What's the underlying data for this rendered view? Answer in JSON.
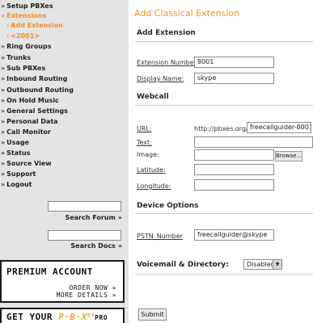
{
  "sidebar": {
    "items": [
      {
        "label": "Setup PBXes",
        "arrow": "»"
      },
      {
        "label": "Extensions",
        "arrow": "»"
      },
      {
        "label": "Add Extension",
        "arrow": "›"
      },
      {
        "label": "<2001>",
        "arrow": "›"
      },
      {
        "label": "Ring Groups",
        "arrow": "»"
      },
      {
        "label": "Trunks",
        "arrow": "»"
      },
      {
        "label": "Sub PBXes",
        "arrow": "»"
      },
      {
        "label": "Inbound Routing",
        "arrow": "»"
      },
      {
        "label": "Outbound Routing",
        "arrow": "»"
      },
      {
        "label": "On Hold Music",
        "arrow": "»"
      },
      {
        "label": "General Settings",
        "arrow": "»"
      },
      {
        "label": "Personal Data",
        "arrow": "»"
      },
      {
        "label": "Call Monitor",
        "arrow": "»"
      },
      {
        "label": "Usage",
        "arrow": "»"
      },
      {
        "label": "Status",
        "arrow": "»"
      },
      {
        "label": "Source View",
        "arrow": "»"
      },
      {
        "label": "Support",
        "arrow": "»"
      },
      {
        "label": "Logout",
        "arrow": "»"
      }
    ],
    "search_forum_label": "Search Forum",
    "search_docs_label": "Search Docs",
    "chevron": "»"
  },
  "promo": {
    "premium_title": "PREMIUM ACCOUNT",
    "order_now": "ORDER NOW »",
    "more_details": "MORE DETAILS »",
    "get_your": "GET YOUR ",
    "brand": "P·B·X",
    "brand_sup": "es",
    "pro": "PRO"
  },
  "main": {
    "title": "Add Classical Extension",
    "add_extension": {
      "heading": "Add Extension",
      "extension_number_label": "Extension Number:",
      "extension_number_value": "8001",
      "display_name_label": "Display Name:",
      "display_name_value": "skype"
    },
    "webcall": {
      "heading": "Webcall",
      "url_label": "URL:",
      "url_prefix": "http://pbxes.org/",
      "url_value": "freecallguider-8001",
      "text_label": "Text:",
      "image_label": "Image:",
      "browse_label": "Browse...",
      "latitude_label": "Latitude:",
      "longitude_label": "Longitude:"
    },
    "device_options": {
      "heading": "Device Options",
      "pstn_label": "PSTN_Number",
      "pstn_value": "freecallguider@skype"
    },
    "voicemail": {
      "label": "Voicemail & Directory:",
      "value": "Disabled"
    },
    "submit_label": "Submit"
  }
}
